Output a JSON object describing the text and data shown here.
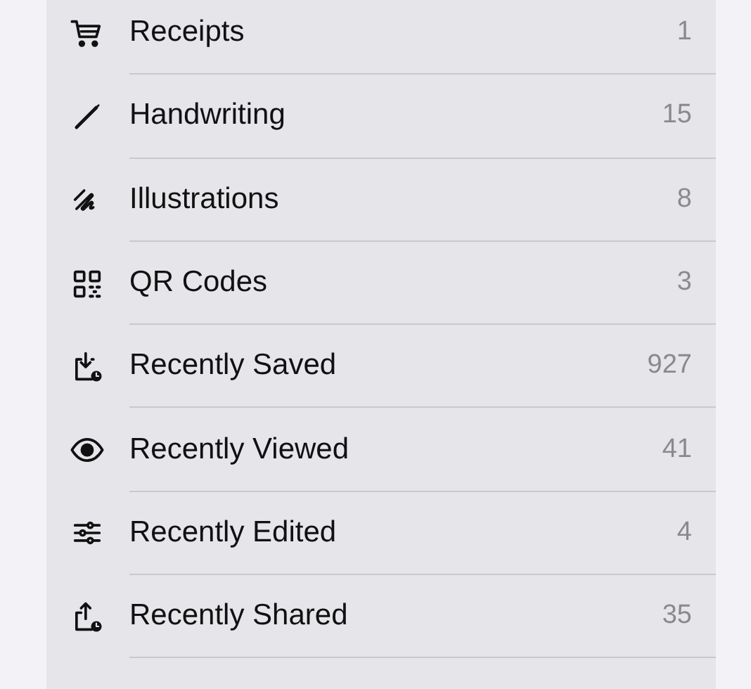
{
  "items": [
    {
      "kind": "cart",
      "label": "Receipts",
      "count": "1"
    },
    {
      "kind": "pen",
      "label": "Handwriting",
      "count": "15"
    },
    {
      "kind": "scribble",
      "label": "Illustrations",
      "count": "8"
    },
    {
      "kind": "qr",
      "label": "QR Codes",
      "count": "3"
    },
    {
      "kind": "saved",
      "label": "Recently Saved",
      "count": "927"
    },
    {
      "kind": "eye",
      "label": "Recently Viewed",
      "count": "41"
    },
    {
      "kind": "sliders",
      "label": "Recently Edited",
      "count": "4"
    },
    {
      "kind": "shared",
      "label": "Recently Shared",
      "count": "35"
    }
  ]
}
